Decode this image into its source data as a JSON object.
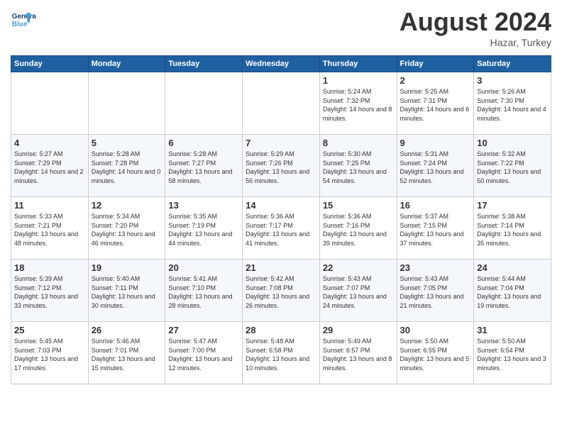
{
  "header": {
    "logo_line1": "General",
    "logo_line2": "Blue",
    "month_title": "August 2024",
    "location": "Hazar, Turkey"
  },
  "days_of_week": [
    "Sunday",
    "Monday",
    "Tuesday",
    "Wednesday",
    "Thursday",
    "Friday",
    "Saturday"
  ],
  "weeks": [
    [
      {
        "day": "",
        "info": ""
      },
      {
        "day": "",
        "info": ""
      },
      {
        "day": "",
        "info": ""
      },
      {
        "day": "",
        "info": ""
      },
      {
        "day": "1",
        "info": "Sunrise: 5:24 AM\nSunset: 7:32 PM\nDaylight: 14 hours\nand 8 minutes."
      },
      {
        "day": "2",
        "info": "Sunrise: 5:25 AM\nSunset: 7:31 PM\nDaylight: 14 hours\nand 6 minutes."
      },
      {
        "day": "3",
        "info": "Sunrise: 5:26 AM\nSunset: 7:30 PM\nDaylight: 14 hours\nand 4 minutes."
      }
    ],
    [
      {
        "day": "4",
        "info": "Sunrise: 5:27 AM\nSunset: 7:29 PM\nDaylight: 14 hours\nand 2 minutes."
      },
      {
        "day": "5",
        "info": "Sunrise: 5:28 AM\nSunset: 7:28 PM\nDaylight: 14 hours\nand 0 minutes."
      },
      {
        "day": "6",
        "info": "Sunrise: 5:28 AM\nSunset: 7:27 PM\nDaylight: 13 hours\nand 58 minutes."
      },
      {
        "day": "7",
        "info": "Sunrise: 5:29 AM\nSunset: 7:26 PM\nDaylight: 13 hours\nand 56 minutes."
      },
      {
        "day": "8",
        "info": "Sunrise: 5:30 AM\nSunset: 7:25 PM\nDaylight: 13 hours\nand 54 minutes."
      },
      {
        "day": "9",
        "info": "Sunrise: 5:31 AM\nSunset: 7:24 PM\nDaylight: 13 hours\nand 52 minutes."
      },
      {
        "day": "10",
        "info": "Sunrise: 5:32 AM\nSunset: 7:22 PM\nDaylight: 13 hours\nand 50 minutes."
      }
    ],
    [
      {
        "day": "11",
        "info": "Sunrise: 5:33 AM\nSunset: 7:21 PM\nDaylight: 13 hours\nand 48 minutes."
      },
      {
        "day": "12",
        "info": "Sunrise: 5:34 AM\nSunset: 7:20 PM\nDaylight: 13 hours\nand 46 minutes."
      },
      {
        "day": "13",
        "info": "Sunrise: 5:35 AM\nSunset: 7:19 PM\nDaylight: 13 hours\nand 44 minutes."
      },
      {
        "day": "14",
        "info": "Sunrise: 5:36 AM\nSunset: 7:17 PM\nDaylight: 13 hours\nand 41 minutes."
      },
      {
        "day": "15",
        "info": "Sunrise: 5:36 AM\nSunset: 7:16 PM\nDaylight: 13 hours\nand 39 minutes."
      },
      {
        "day": "16",
        "info": "Sunrise: 5:37 AM\nSunset: 7:15 PM\nDaylight: 13 hours\nand 37 minutes."
      },
      {
        "day": "17",
        "info": "Sunrise: 5:38 AM\nSunset: 7:14 PM\nDaylight: 13 hours\nand 35 minutes."
      }
    ],
    [
      {
        "day": "18",
        "info": "Sunrise: 5:39 AM\nSunset: 7:12 PM\nDaylight: 13 hours\nand 33 minutes."
      },
      {
        "day": "19",
        "info": "Sunrise: 5:40 AM\nSunset: 7:11 PM\nDaylight: 13 hours\nand 30 minutes."
      },
      {
        "day": "20",
        "info": "Sunrise: 5:41 AM\nSunset: 7:10 PM\nDaylight: 13 hours\nand 28 minutes."
      },
      {
        "day": "21",
        "info": "Sunrise: 5:42 AM\nSunset: 7:08 PM\nDaylight: 13 hours\nand 26 minutes."
      },
      {
        "day": "22",
        "info": "Sunrise: 5:43 AM\nSunset: 7:07 PM\nDaylight: 13 hours\nand 24 minutes."
      },
      {
        "day": "23",
        "info": "Sunrise: 5:43 AM\nSunset: 7:05 PM\nDaylight: 13 hours\nand 21 minutes."
      },
      {
        "day": "24",
        "info": "Sunrise: 5:44 AM\nSunset: 7:04 PM\nDaylight: 13 hours\nand 19 minutes."
      }
    ],
    [
      {
        "day": "25",
        "info": "Sunrise: 5:45 AM\nSunset: 7:03 PM\nDaylight: 13 hours\nand 17 minutes."
      },
      {
        "day": "26",
        "info": "Sunrise: 5:46 AM\nSunset: 7:01 PM\nDaylight: 13 hours\nand 15 minutes."
      },
      {
        "day": "27",
        "info": "Sunrise: 5:47 AM\nSunset: 7:00 PM\nDaylight: 13 hours\nand 12 minutes."
      },
      {
        "day": "28",
        "info": "Sunrise: 5:48 AM\nSunset: 6:58 PM\nDaylight: 13 hours\nand 10 minutes."
      },
      {
        "day": "29",
        "info": "Sunrise: 5:49 AM\nSunset: 6:57 PM\nDaylight: 13 hours\nand 8 minutes."
      },
      {
        "day": "30",
        "info": "Sunrise: 5:50 AM\nSunset: 6:55 PM\nDaylight: 13 hours\nand 5 minutes."
      },
      {
        "day": "31",
        "info": "Sunrise: 5:50 AM\nSunset: 6:54 PM\nDaylight: 13 hours\nand 3 minutes."
      }
    ]
  ]
}
